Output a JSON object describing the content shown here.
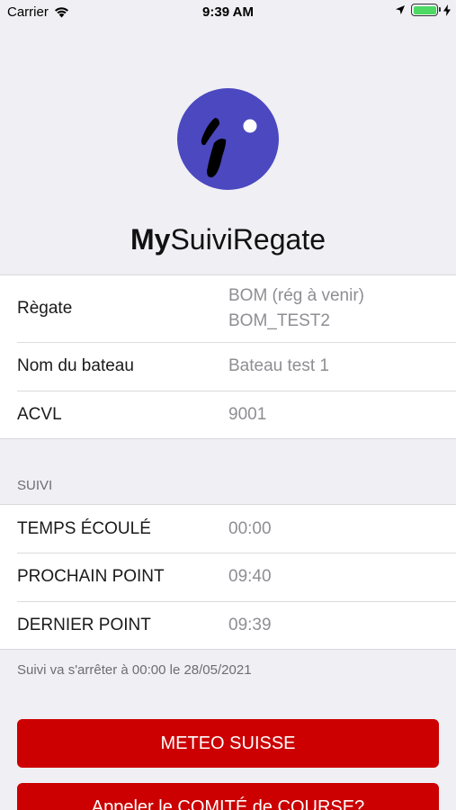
{
  "status_bar": {
    "carrier": "Carrier",
    "time": "9:39 AM"
  },
  "header": {
    "title_bold": "My",
    "title_rest": "SuiviRegate",
    "logo_color": "#4b48c0"
  },
  "info": {
    "regate_label": "Règate",
    "regate_value_line1": "BOM (rég à venir)",
    "regate_value_line2": "BOM_TEST2",
    "boat_label": "Nom du bateau",
    "boat_value": "Bateau test 1",
    "acvl_label": "ACVL",
    "acvl_value": "9001"
  },
  "suivi": {
    "section_title": "SUIVI",
    "elapsed_label": "TEMPS ÉCOULÉ",
    "elapsed_value": "00:00",
    "next_label": "PROCHAIN POINT",
    "next_value": "09:40",
    "last_label": "DERNIER POINT",
    "last_value": "09:39",
    "footer": "Suivi va s'arrêter à 00:00 le 28/05/2021"
  },
  "buttons": {
    "meteo": "METEO SUISSE",
    "call": "Appeler le COMITÉ de COURSE?"
  },
  "colors": {
    "accent": "#cc0000",
    "background": "#efeff4"
  }
}
